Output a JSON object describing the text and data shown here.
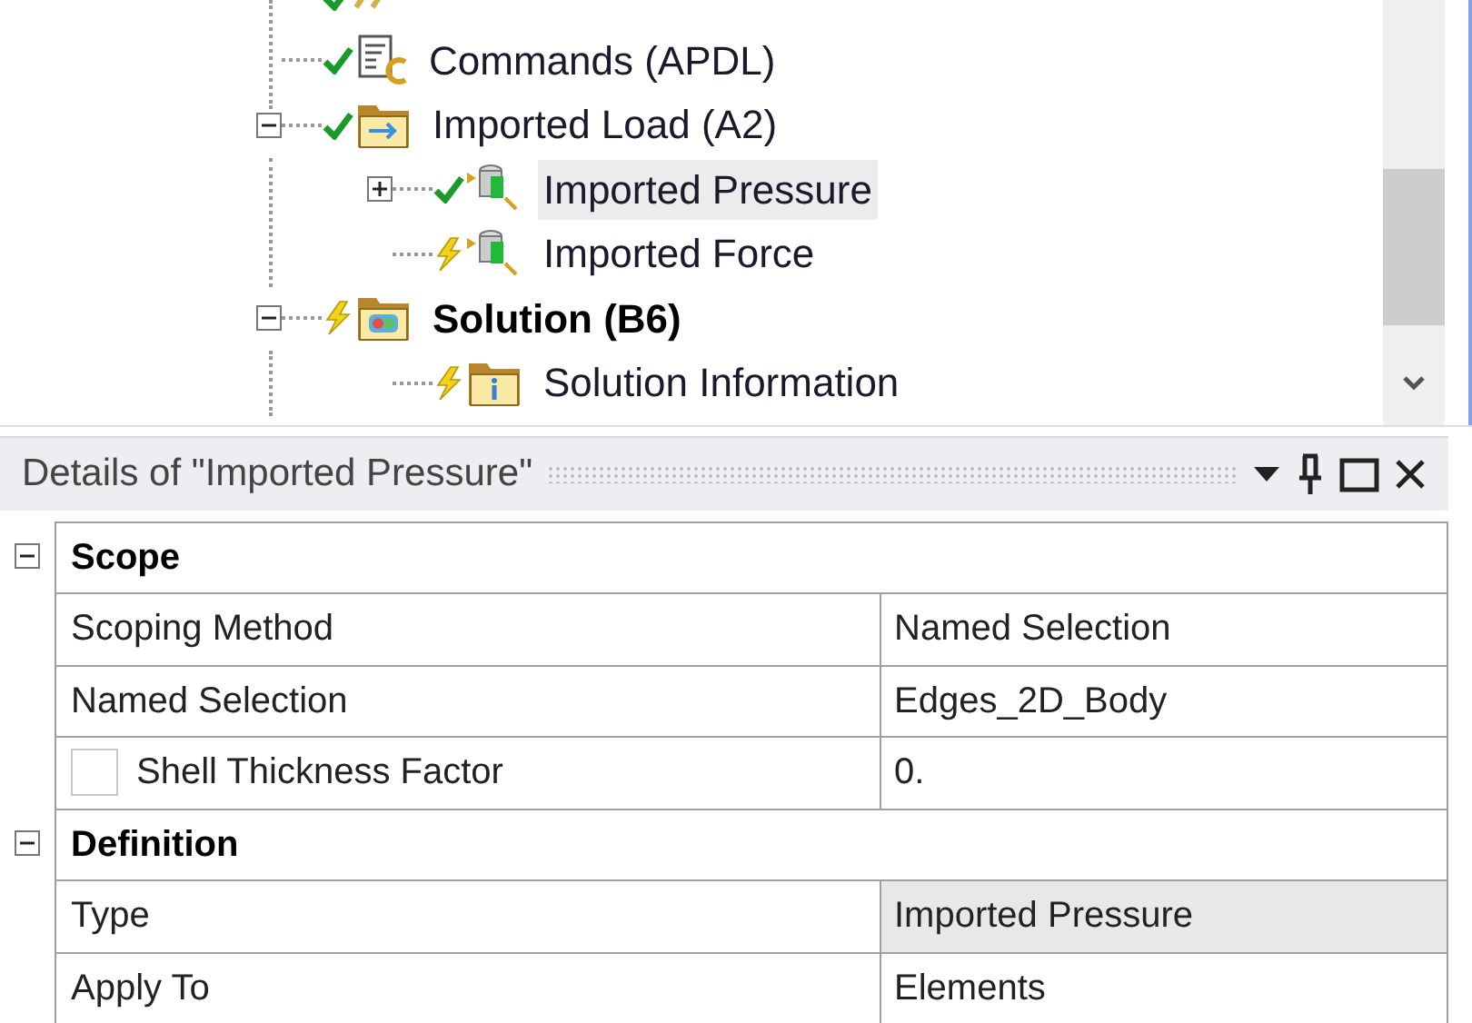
{
  "tree": [
    {
      "solved": true,
      "kind": "support"
    },
    {
      "label": "Commands (APDL)",
      "solved": true,
      "kind": "commands",
      "bold": false,
      "selected": false
    },
    {
      "label": "Imported Load (A2)",
      "solved": true,
      "kind": "folder-load",
      "bold": false,
      "selected": false,
      "expanded": true,
      "children": [
        {
          "label": "Imported Pressure",
          "solved": true,
          "kind": "load",
          "bold": false,
          "selected": true,
          "expanded": false
        },
        {
          "label": "Imported Force",
          "solved": false,
          "kind": "load",
          "bold": false,
          "selected": false
        }
      ]
    },
    {
      "label": "Solution (B6)",
      "solved": false,
      "kind": "folder-solution",
      "bold": true,
      "selected": false,
      "expanded": true,
      "children": [
        {
          "label": "Solution Information",
          "solved": false,
          "kind": "info",
          "bold": false,
          "selected": false
        }
      ]
    }
  ],
  "details": {
    "title": "Details of \"Imported Pressure\"",
    "sections": [
      {
        "title": "Scope",
        "expanded": true,
        "rows": [
          {
            "name": "Scoping Method",
            "value": "Named Selection",
            "readonly": false
          },
          {
            "name": "Named Selection",
            "value": "Edges_2D_Body",
            "readonly": false
          },
          {
            "name": "Shell Thickness Factor",
            "value": "0.",
            "checked": false,
            "readonly": false
          }
        ]
      },
      {
        "title": "Definition",
        "expanded": true,
        "rows": [
          {
            "name": "Type",
            "value": "Imported Pressure",
            "readonly": true
          },
          {
            "name": "Apply To",
            "value": "Elements",
            "readonly": false
          }
        ]
      }
    ]
  }
}
